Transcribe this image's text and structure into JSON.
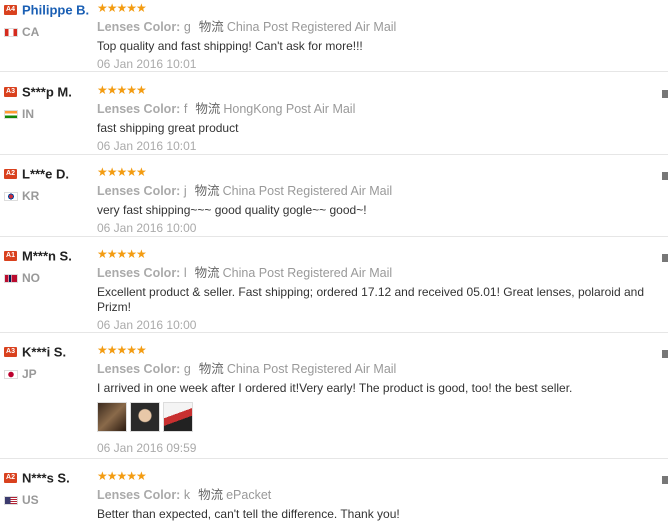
{
  "reviews": [
    {
      "badge": "A4",
      "name": "Philippe B.",
      "country": "CA",
      "meta_label": "Lenses Color:",
      "meta_value": "g",
      "shipping_label": "物流",
      "shipping": "China Post Registered Air Mail",
      "text": "Top quality and fast shipping! Can't ask for more!!!",
      "date": "06 Jan 2016 10:01",
      "stars": "★★★★★"
    },
    {
      "badge": "A3",
      "name": "S***p M.",
      "country": "IN",
      "meta_label": "Lenses Color:",
      "meta_value": "f",
      "shipping_label": "物流",
      "shipping": "HongKong Post Air Mail",
      "text": "fast shipping great product",
      "date": "06 Jan 2016 10:01",
      "stars": "★★★★★"
    },
    {
      "badge": "A2",
      "name": "L***e D.",
      "country": "KR",
      "meta_label": "Lenses Color:",
      "meta_value": "j",
      "shipping_label": "物流",
      "shipping": "China Post Registered Air Mail",
      "text": "very fast shipping~~~ good quality gogle~~ good~!",
      "date": "06 Jan 2016 10:00",
      "stars": "★★★★★"
    },
    {
      "badge": "A1",
      "name": "M***n S.",
      "country": "NO",
      "meta_label": "Lenses Color:",
      "meta_value": "l",
      "shipping_label": "物流",
      "shipping": "China Post Registered Air Mail",
      "text": "Excellent product & seller. Fast shipping; ordered 17.12 and received 05.01! Great lenses, polaroid and Prizm!",
      "date": "06 Jan 2016 10:00",
      "stars": "★★★★★"
    },
    {
      "badge": "A3",
      "name": "K***i S.",
      "country": "JP",
      "meta_label": "Lenses Color:",
      "meta_value": "g",
      "shipping_label": "物流",
      "shipping": "China Post Registered Air Mail",
      "text": "I arrived in one week after I ordered it!Very early! The product is good, too! the best seller.",
      "date": "06 Jan 2016 09:59",
      "stars": "★★★★★"
    },
    {
      "badge": "A2",
      "name": "N***s S.",
      "country": "US",
      "meta_label": "Lenses Color:",
      "meta_value": "k",
      "shipping_label": "物流",
      "shipping": "ePacket",
      "text": "Better than expected, can't tell the difference. Thank you!",
      "date": "",
      "stars": "★★★★★"
    }
  ]
}
